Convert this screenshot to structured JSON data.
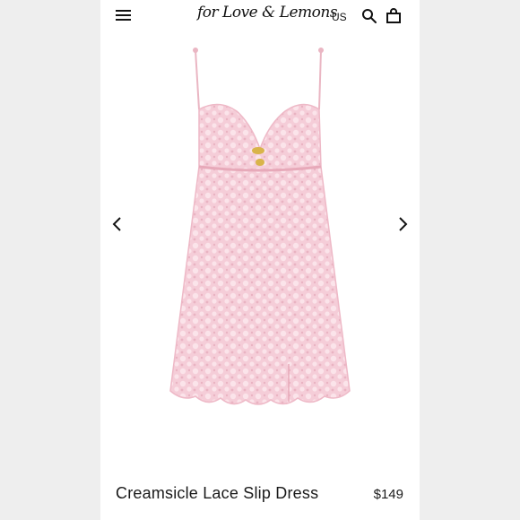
{
  "header": {
    "brand": "for Love & Lemons",
    "region": "US",
    "menu_icon": "hamburger-menu-icon",
    "search_icon": "search-icon",
    "bag_icon": "shopping-bag-icon"
  },
  "gallery": {
    "prev_icon": "chevron-left-icon",
    "next_icon": "chevron-right-icon",
    "dress_color": "#f3c9d4"
  },
  "product": {
    "name": "Creamsicle Lace Slip Dress",
    "price": "$149"
  }
}
